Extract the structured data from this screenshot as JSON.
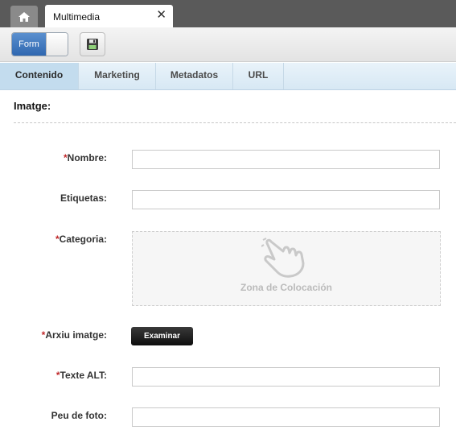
{
  "window": {
    "tab_label": "Multimedia",
    "close_glyph": "✕"
  },
  "toolbar": {
    "form_toggle_label": "Form",
    "save_icon": "floppy-disk-icon"
  },
  "tabs": [
    {
      "label": "Contenido",
      "active": true
    },
    {
      "label": "Marketing",
      "active": false
    },
    {
      "label": "Metadatos",
      "active": false
    },
    {
      "label": "URL",
      "active": false
    }
  ],
  "section": {
    "title": "Imatge:"
  },
  "form": {
    "required_mark": "*",
    "fields": {
      "nombre": {
        "label": "Nombre:",
        "value": "",
        "required": true
      },
      "etiquetas": {
        "label": "Etiquetas:",
        "value": "",
        "required": false
      },
      "categoria": {
        "label": "Categoria:",
        "required": true,
        "dropzone_text": "Zona de Colocación"
      },
      "arxiu": {
        "label": "Arxiu imatge:",
        "required": true,
        "button_label": "Examinar"
      },
      "texte_alt": {
        "label": "Texte ALT:",
        "value": "",
        "required": true
      },
      "peu": {
        "label": "Peu de foto:",
        "value": "",
        "required": false
      }
    }
  }
}
